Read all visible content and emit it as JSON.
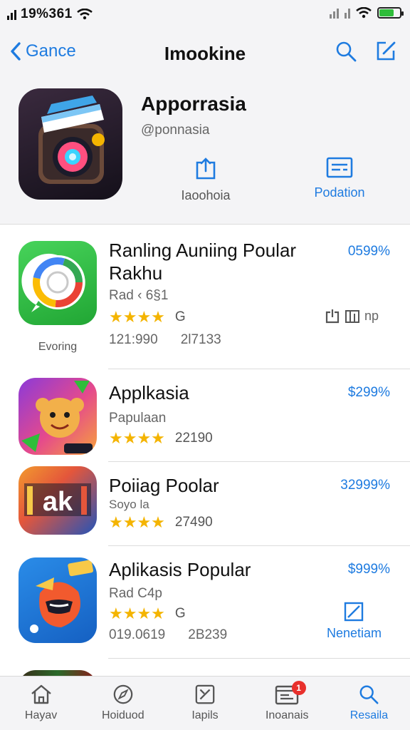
{
  "status": {
    "time": "19%361"
  },
  "nav": {
    "back_label": "Gance",
    "title": "Imookine"
  },
  "header": {
    "app_title": "Apporrasia",
    "handle": "@ponnasia",
    "action1_label": "Iaoohoia",
    "action2_label": "Podation"
  },
  "apps": [
    {
      "name": "Ranling Auniing Poular Rakhu",
      "sub": "Rad ‹ 6§1",
      "stars": "★★★★",
      "rating_suffix": "G",
      "stat1": "121:990",
      "stat2": "2l7133",
      "price": "0599%",
      "caption": "Evoring",
      "side_label": "np"
    },
    {
      "name": "Applkasia",
      "sub": "Papulaan",
      "stars": "★★★★",
      "rating_suffix": "22190",
      "price": "$299%"
    },
    {
      "name": "Poiiag Poolar",
      "sub": "Soyo la",
      "stars": "★★★★",
      "rating_suffix": "27490",
      "price": "32999%"
    },
    {
      "name": "Aplikasis Popular",
      "sub": "Rad C4p",
      "stars": "★★★★",
      "rating_suffix": "G",
      "stat1": "019.0619",
      "stat2": "2B239",
      "price": "$999%",
      "side_label": "Nenetiam"
    }
  ],
  "tabs": [
    {
      "label": "Hayav",
      "icon": "home-icon"
    },
    {
      "label": "Hoiduod",
      "icon": "compass-icon"
    },
    {
      "label": "Iapils",
      "icon": "games-icon"
    },
    {
      "label": "Inoanais",
      "icon": "updates-icon",
      "badge": "1"
    },
    {
      "label": "Resaila",
      "icon": "search-icon"
    }
  ],
  "colors": {
    "accent": "#1e7be0",
    "star": "#f4b400",
    "badge": "#e8302c",
    "battery": "#2fbd3a"
  }
}
